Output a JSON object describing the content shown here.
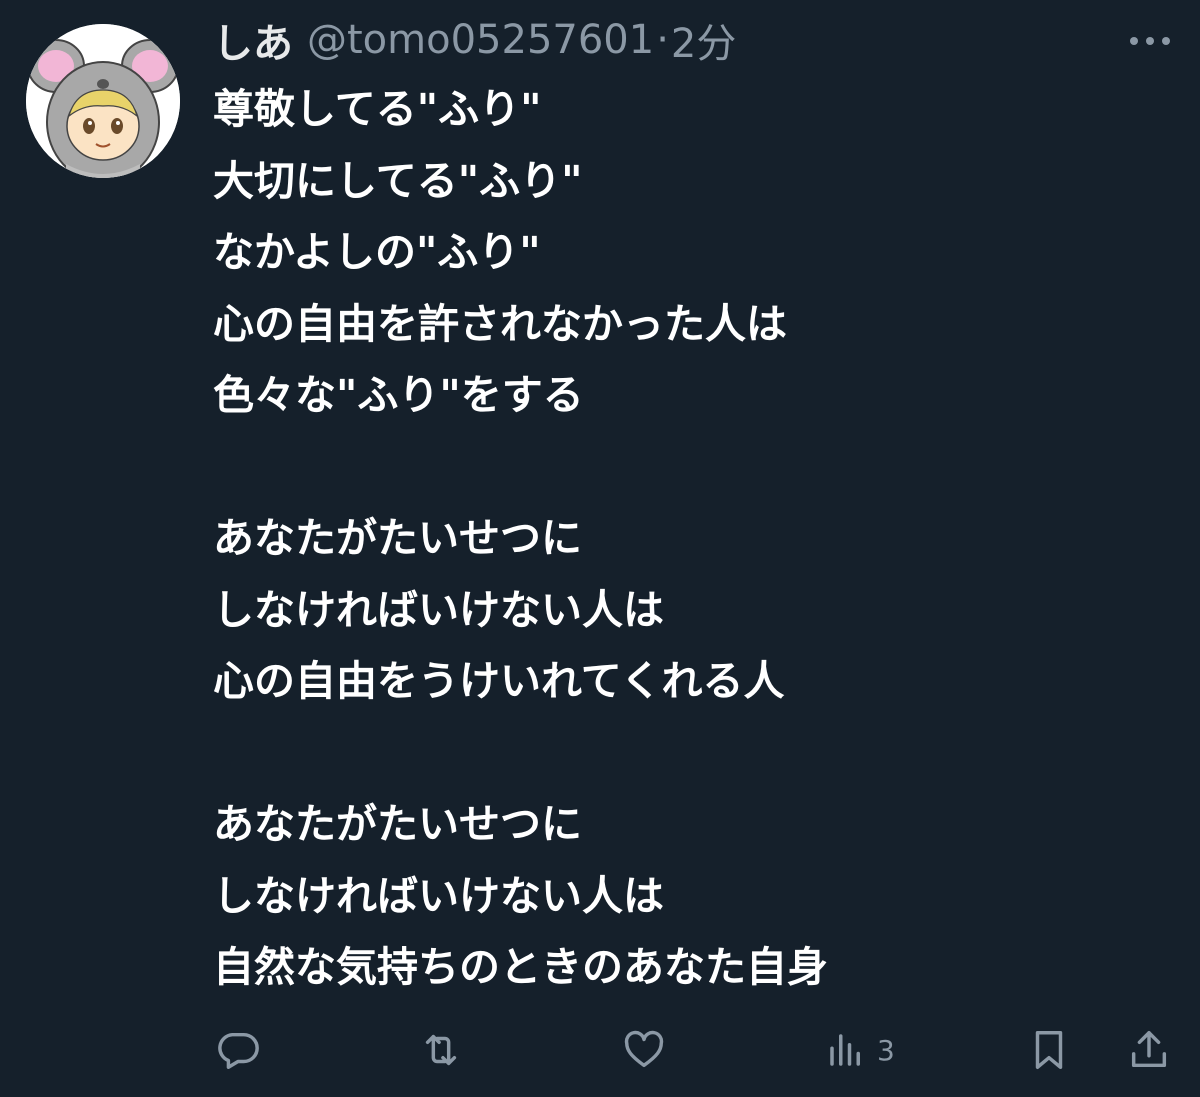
{
  "user": {
    "display_name": "しあ",
    "handle": "@tomo05257601",
    "separator": "·",
    "time": "2分"
  },
  "tweet": {
    "lines": [
      "尊敬してる\"ふり\"",
      "大切にしてる\"ふり\"",
      "なかよしの\"ふり\"",
      "心の自由を許されなかった人は",
      "色々な\"ふり\"をする",
      "",
      "あなたがたいせつに",
      "しなければいけない人は",
      "心の自由をうけいれてくれる人",
      "",
      "あなたがたいせつに",
      "しなければいけない人は",
      "自然な気持ちのときのあなた自身"
    ]
  },
  "actions": {
    "reply": {
      "icon": "reply-icon"
    },
    "retweet": {
      "icon": "retweet-icon"
    },
    "like": {
      "icon": "heart-icon"
    },
    "views": {
      "icon": "views-icon",
      "count": "3"
    },
    "bookmark": {
      "icon": "bookmark-icon"
    },
    "share": {
      "icon": "share-icon"
    }
  },
  "colors": {
    "background": "#15202b",
    "text_primary": "#ffffff",
    "text_secondary": "#8b98a5"
  }
}
